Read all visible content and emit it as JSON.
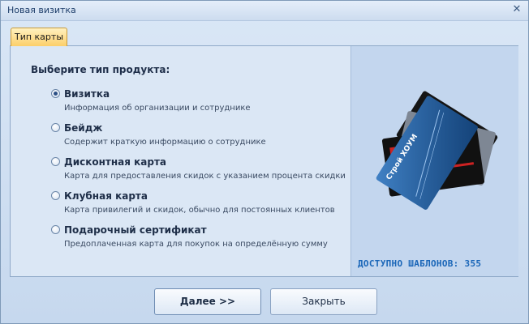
{
  "window": {
    "title": "Новая визитка",
    "close_icon": "close-icon"
  },
  "tab": {
    "label": "Тип карты"
  },
  "prompt": "Выберите тип продукта:",
  "options": [
    {
      "label": "Визитка",
      "description": "Информация об организации и сотруднике",
      "selected": true
    },
    {
      "label": "Бейдж",
      "description": "Содержит краткую информацию о сотруднике",
      "selected": false
    },
    {
      "label": "Дисконтная карта",
      "description": "Карта для предоставления скидок с указанием процента скидки",
      "selected": false
    },
    {
      "label": "Клубная карта",
      "description": "Карта привилегий и скидок, обычно для постоянных клиентов",
      "selected": false
    },
    {
      "label": "Подарочный сертификат",
      "description": "Предоплаченная карта для покупок на определённую сумму",
      "selected": false
    }
  ],
  "preview": {
    "card_text": "Строй ХОУМ",
    "templates_label": "ДОСТУПНО ШАБЛОНОВ: 355"
  },
  "buttons": {
    "next": "Далее >>",
    "close": "Закрыть"
  },
  "colors": {
    "tab_accent": "#fccf6a",
    "templates_text": "#1a66b8",
    "card_blue": "#1f5fa3"
  }
}
